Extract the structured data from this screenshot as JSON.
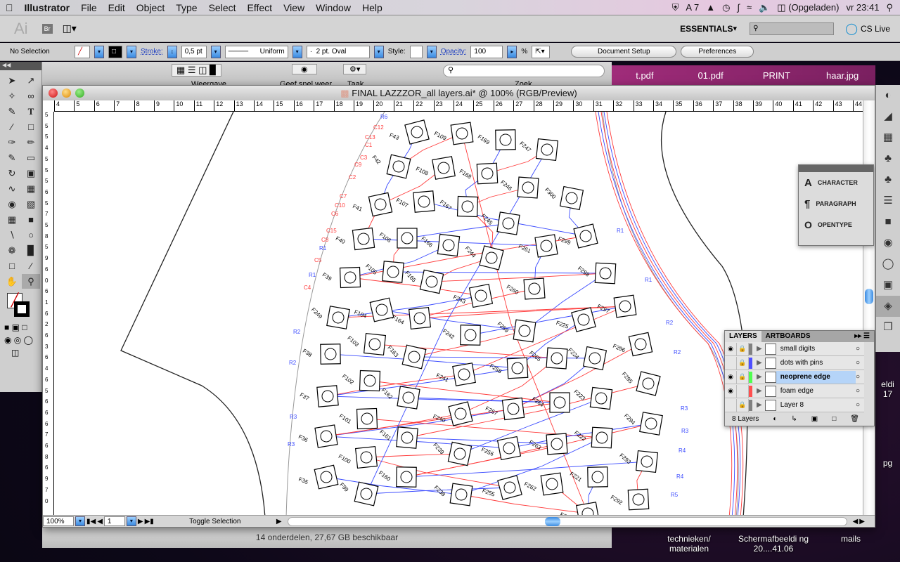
{
  "menubar": {
    "app": "Illustrator",
    "items": [
      "File",
      "Edit",
      "Object",
      "Type",
      "Select",
      "Effect",
      "View",
      "Window",
      "Help"
    ],
    "status": {
      "adobe": "7",
      "battery": "(Opgeladen)",
      "clock": "vr 23:41"
    }
  },
  "appbar": {
    "logo": "Ai",
    "bridge": "Br",
    "workspace": "ESSENTIALS",
    "search_placeholder": "",
    "cs_live": "CS Live"
  },
  "control": {
    "selection": "No Selection",
    "stroke_label": "Stroke:",
    "stroke_weight": "0,5 pt",
    "profile": "Uniform",
    "brush": "2 pt. Oval",
    "style_label": "Style:",
    "opacity_label": "Opacity:",
    "opacity": "100",
    "percent": "%",
    "doc_setup": "Document Setup",
    "preferences": "Preferences"
  },
  "finder": {
    "view_label": "Weergave",
    "quicklook_label": "Geef snel weer",
    "task_label": "Taak",
    "search_label": "Zoek",
    "status": "14 onderdelen, 27,67 GB beschikbaar"
  },
  "desktop_tabs": [
    "t.pdf",
    "01.pdf",
    "PRINT",
    "haar.jpg"
  ],
  "desktop_icons": [
    {
      "label": "technieken/ materialen"
    },
    {
      "label": "Schermafbeeldi ng 20....41.06"
    },
    {
      "label": "mails"
    },
    {
      "label": "eldi 17"
    },
    {
      "label": "pg"
    }
  ],
  "document": {
    "title": "FINAL LAZZZOR_all layers.ai* @ 100% (RGB/Preview)",
    "zoom": "100%",
    "artboard": "1",
    "status": "Toggle Selection",
    "ruler_h": [
      "4",
      "5",
      "6",
      "7",
      "8",
      "9",
      "10",
      "11",
      "12",
      "13",
      "14",
      "15",
      "16",
      "17",
      "18",
      "19",
      "20",
      "21",
      "22",
      "23",
      "24",
      "25",
      "26",
      "27",
      "28",
      "29",
      "30",
      "31",
      "32",
      "33",
      "34",
      "35",
      "36",
      "37",
      "38",
      "39",
      "40",
      "41",
      "42",
      "43",
      "44"
    ],
    "ruler_v": [
      "5",
      "5",
      "5",
      "4",
      "5",
      "5",
      "5",
      "6",
      "5",
      "7",
      "5",
      "8",
      "5",
      "9",
      "6",
      "0",
      "6",
      "1",
      "6",
      "2",
      "6",
      "3",
      "6",
      "4",
      "6",
      "5",
      "6",
      "6",
      "6",
      "7",
      "6",
      "8",
      "6",
      "9",
      "7",
      "0"
    ],
    "pads": [
      "F43",
      "F109",
      "F169",
      "F247",
      "F42",
      "F108",
      "F168",
      "F246",
      "F300",
      "F41",
      "F107",
      "F167",
      "F245",
      "F299",
      "F40",
      "F106",
      "F166",
      "F244",
      "F261",
      "F39",
      "F105",
      "F165",
      "F243",
      "F260",
      "F298",
      "F249",
      "F104",
      "F164",
      "F242",
      "F259",
      "F225",
      "F297",
      "F38",
      "F103",
      "F163",
      "F241",
      "F258",
      "F265",
      "F224",
      "F296",
      "F37",
      "F102",
      "F162",
      "F240",
      "F257",
      "F264",
      "F223",
      "F295",
      "F36",
      "F101",
      "F161",
      "F239",
      "F256",
      "F263",
      "F222",
      "F294",
      "F35",
      "F100",
      "F160",
      "F238",
      "F255",
      "F262",
      "F221",
      "F293",
      "F99",
      "F220",
      "F292"
    ],
    "red_labels": [
      "C12",
      "C13",
      "C1",
      "C3",
      "C9",
      "C2",
      "C7",
      "C10",
      "C6",
      "C15",
      "C8",
      "C5",
      "C4"
    ],
    "blue_labels": [
      "R6",
      "R1",
      "R1",
      "R2",
      "R2",
      "R3",
      "R3",
      "R1",
      "R1",
      "R2",
      "R2",
      "R3",
      "R3",
      "R4",
      "R4",
      "R5"
    ]
  },
  "character_panel": {
    "items": [
      "CHARACTER",
      "PARAGRAPH",
      "OPENTYPE"
    ]
  },
  "layers_panel": {
    "tabs": [
      "LAYERS",
      "ARTBOARDS"
    ],
    "count": "8 Layers",
    "layers": [
      {
        "name": "small digits",
        "visible": true,
        "locked": true,
        "color": "#808080",
        "selected": false
      },
      {
        "name": "dots with pins",
        "visible": false,
        "locked": true,
        "color": "#4f4fff",
        "selected": false
      },
      {
        "name": "neoprene edge",
        "visible": true,
        "locked": true,
        "color": "#4fff4f",
        "selected": true
      },
      {
        "name": "foam edge",
        "visible": true,
        "locked": false,
        "color": "#ff4f4f",
        "selected": false
      },
      {
        "name": "Layer 8",
        "visible": false,
        "locked": true,
        "color": "#808080",
        "selected": false
      }
    ]
  },
  "colors": {
    "red_path": "#ff3b3b",
    "blue_path": "#3b4bff",
    "selection": "#b5d4f8"
  }
}
